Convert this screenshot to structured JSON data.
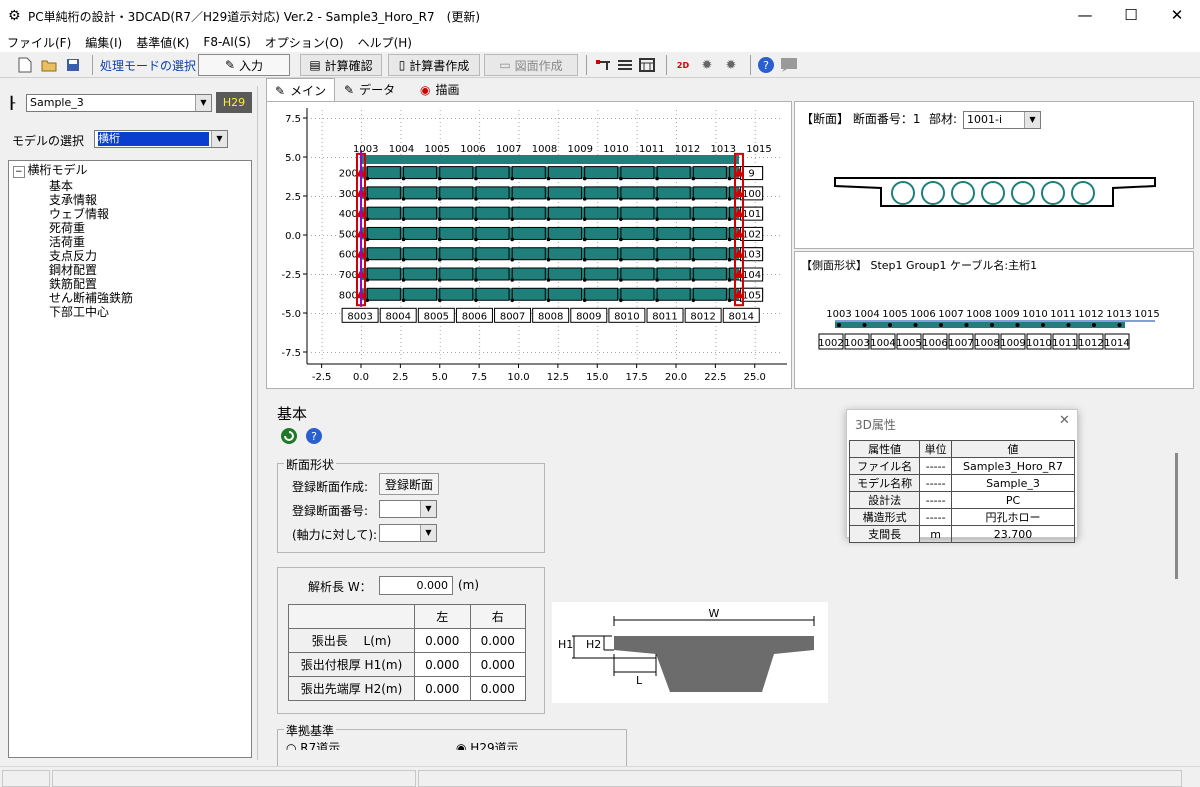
{
  "window": {
    "title": "PC単純桁の設計・3DCAD(R7／H29道示対応) Ver.2 - Sample3_Horo_R7　(更新)",
    "minimize": "—",
    "maximize": "☐",
    "close": "✕"
  },
  "menu": [
    "ファイル(F)",
    "編集(I)",
    "基準値(K)",
    "F8-AI(S)",
    "オプション(O)",
    "ヘルプ(H)"
  ],
  "toolbar": {
    "mode_label": "処理モードの選択",
    "input": "入力",
    "calc_check": "計算確認",
    "report": "計算書作成",
    "drawing": "図面作成"
  },
  "left": {
    "project": "Sample_3",
    "badge": "H29",
    "model_label": "モデルの選択",
    "model_value": "横桁",
    "tree_root": "横桁モデル",
    "tree_items": [
      "基本",
      "支承情報",
      "ウェブ情報",
      "死荷重",
      "活荷重",
      "支点反力",
      "鋼材配置",
      "鉄筋配置",
      "せん断補強鉄筋",
      "下部工中心"
    ]
  },
  "tabs": [
    "メイン",
    "データ",
    "描画"
  ],
  "plot": {
    "yticks": [
      "7.5",
      "5.0",
      "2.5",
      "0.0",
      "-2.5",
      "-5.0",
      "-7.5"
    ],
    "xticks": [
      "-2.5",
      "0.0",
      "2.5",
      "5.0",
      "7.5",
      "10.0",
      "12.5",
      "15.0",
      "17.5",
      "20.0",
      "22.5",
      "25.0"
    ],
    "top_labels": [
      "1003",
      "1004",
      "1005",
      "1006",
      "1007",
      "1008",
      "1009",
      "1010",
      "1011",
      "1012",
      "1013",
      "1015"
    ],
    "left_labels": [
      "200",
      "300",
      "400",
      "500",
      "600",
      "700",
      "800"
    ],
    "right_labels": [
      "9",
      "100",
      "101",
      "102",
      "103",
      "104",
      "105"
    ],
    "bottom_labels": [
      "8003",
      "8004",
      "8005",
      "8006",
      "8007",
      "8008",
      "8009",
      "8010",
      "8011",
      "8012",
      "8014"
    ]
  },
  "section": {
    "title": "【断面】 断面番号：1",
    "member_label": "部材:",
    "member_value": "1001-i"
  },
  "side": {
    "title": "【側面形状】 Step1 Group1 ケーブル名:主桁1",
    "top_labels": [
      "1003",
      "1004",
      "1005",
      "1006",
      "1007",
      "1008",
      "1009",
      "1010",
      "1011",
      "1012",
      "1013",
      "1015"
    ],
    "bottom_labels": [
      "1002",
      "1003",
      "1004",
      "1005",
      "1006",
      "1007",
      "1008",
      "1009",
      "1010",
      "1011",
      "1012",
      "1014"
    ]
  },
  "basic": {
    "heading": "基本",
    "shape_group": "断面形状",
    "reg_create_label": "登録断面作成:",
    "reg_create_btn": "登録断面",
    "reg_no_label": "登録断面番号:",
    "axial_label": "(軸力に対して):",
    "length_label": "解析長 W：",
    "length_value": "0.000",
    "length_unit": "(m)",
    "table": {
      "headers": [
        "左",
        "右"
      ],
      "rows": [
        {
          "label": "張出長　 L(m)",
          "left": "0.000",
          "right": "0.000"
        },
        {
          "label": "張出付根厚 H1(m)",
          "left": "0.000",
          "right": "0.000"
        },
        {
          "label": "張出先端厚 H2(m)",
          "left": "0.000",
          "right": "0.000"
        }
      ]
    },
    "diagram": {
      "w": "W",
      "h1": "H1",
      "h2": "H2",
      "l": "L"
    },
    "standard_group": "準拠基準",
    "opt_r7": "R7道示",
    "opt_h29": "H29道示"
  },
  "attr3d": {
    "title": "3D属性",
    "headers": [
      "属性値",
      "単位",
      "値"
    ],
    "rows": [
      [
        "ファイル名",
        "-----",
        "Sample3_Horo_R7"
      ],
      [
        "モデル名称",
        "-----",
        "Sample_3"
      ],
      [
        "設計法",
        "-----",
        "PC"
      ],
      [
        "構造形式",
        "-----",
        "円孔ホロー"
      ],
      [
        "支間長",
        "m",
        "23.700"
      ]
    ]
  },
  "colors": {
    "beam": "#1f7f7a",
    "accent": "#0b3fa8",
    "highlight": "#0a3ecf"
  }
}
